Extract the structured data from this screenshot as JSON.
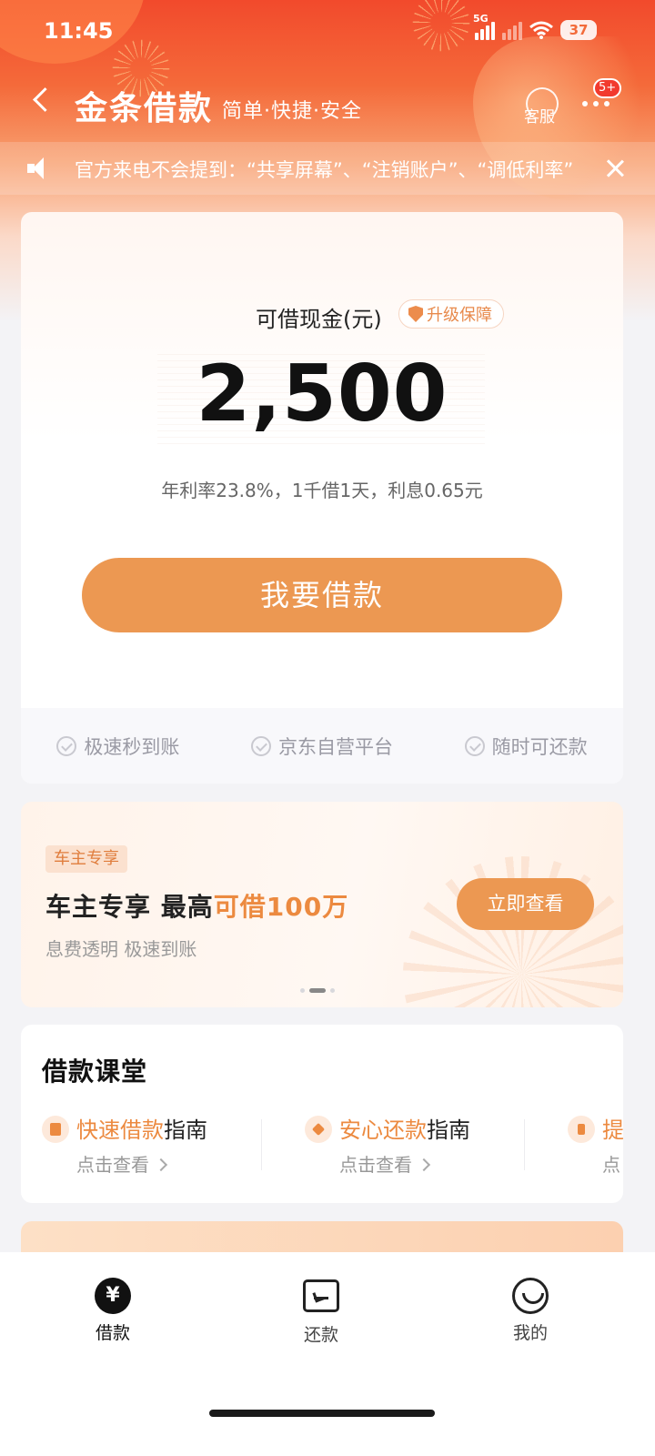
{
  "status_bar": {
    "time": "11:45",
    "network": "5G",
    "battery": "37"
  },
  "nav": {
    "title": "金条借款",
    "subtitle": "简单·快捷·安全",
    "service_label": "客服",
    "more_badge": "5+"
  },
  "notice": {
    "text": "官方来电不会提到：“共享屏幕”、“注销账户”、“调低利率”"
  },
  "loan": {
    "amount_label": "可借现金(元)",
    "upgrade_label": "升级保障",
    "amount": "2,500",
    "rate_info": "年利率23.8%，1千借1天，利息0.65元",
    "borrow_button": "我要借款",
    "features": [
      "极速秒到账",
      "京东自营平台",
      "随时可还款"
    ]
  },
  "promo": {
    "tag": "车主专享",
    "title_main": "车主专享 最高",
    "title_highlight": "可借100万",
    "subtitle": "息费透明 极速到账",
    "button": "立即查看",
    "page_count": 3,
    "active_page": 2
  },
  "classroom": {
    "title": "借款课堂",
    "guides": [
      {
        "highlight": "快速借款",
        "suffix": "指南",
        "link": "点击查看"
      },
      {
        "highlight": "安心还款",
        "suffix": "指南",
        "link": "点击查看"
      },
      {
        "highlight": "提",
        "suffix": "",
        "link": "点"
      }
    ]
  },
  "tabs": [
    {
      "label": "借款",
      "icon": "yen-icon",
      "active": true
    },
    {
      "label": "还款",
      "icon": "repay-icon",
      "active": false
    },
    {
      "label": "我的",
      "icon": "smiley-icon",
      "active": false
    }
  ],
  "colors": {
    "accent": "#ec9852",
    "highlight": "#ec8a40",
    "brand_red": "#f24a2c"
  }
}
